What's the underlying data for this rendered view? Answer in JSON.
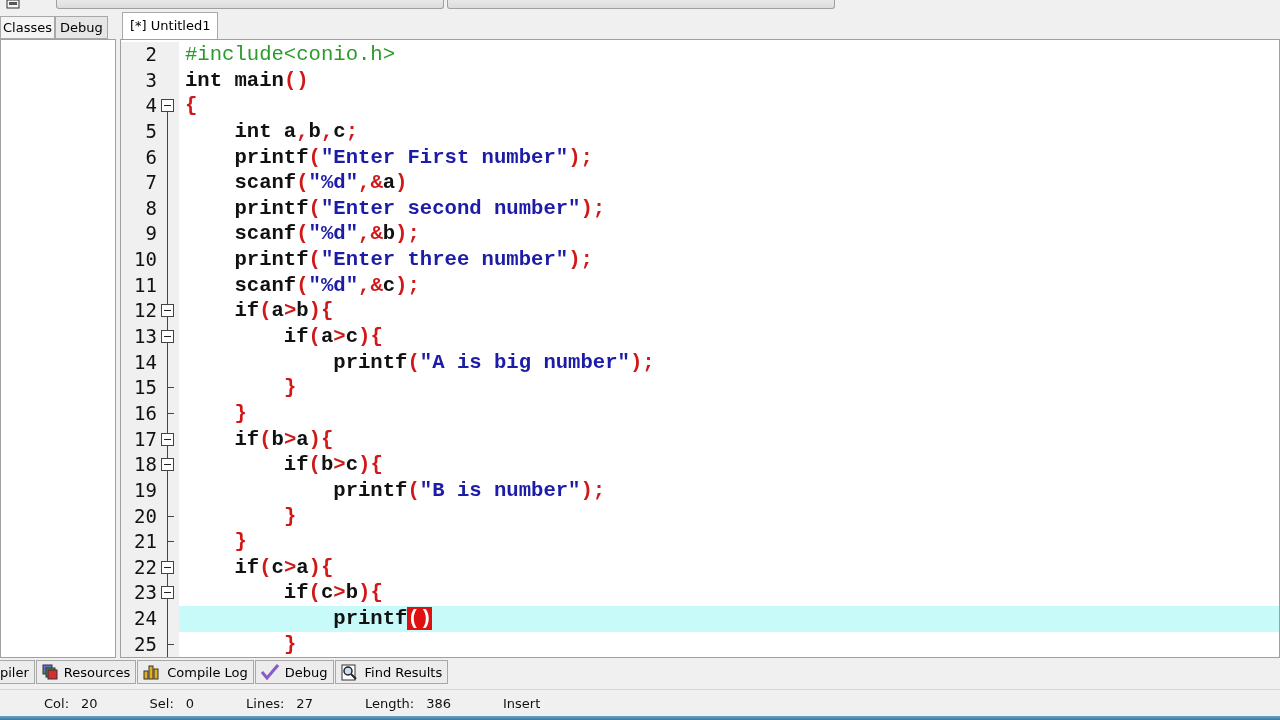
{
  "left_panel": {
    "tabs": [
      {
        "label": "Classes",
        "selected": true
      },
      {
        "label": "Debug",
        "selected": false
      }
    ]
  },
  "editor": {
    "tab": {
      "label": "[*] Untitled1"
    },
    "lines": [
      {
        "number": "2",
        "kind": "none",
        "code": "#include<conio.h>",
        "current": false
      },
      {
        "number": "3",
        "kind": "none",
        "code": "int main()",
        "current": false
      },
      {
        "number": "4",
        "kind": "start",
        "code": "{",
        "current": false
      },
      {
        "number": "5",
        "kind": "body",
        "code": "    int a,b,c;",
        "current": false
      },
      {
        "number": "6",
        "kind": "body",
        "code": "    printf(\"Enter First number\");",
        "current": false
      },
      {
        "number": "7",
        "kind": "body",
        "code": "    scanf(\"%d\",&a)",
        "current": false
      },
      {
        "number": "8",
        "kind": "body",
        "code": "    printf(\"Enter second number\");",
        "current": false
      },
      {
        "number": "9",
        "kind": "body",
        "code": "    scanf(\"%d\",&b);",
        "current": false
      },
      {
        "number": "10",
        "kind": "body",
        "code": "    printf(\"Enter three number\");",
        "current": false
      },
      {
        "number": "11",
        "kind": "body",
        "code": "    scanf(\"%d\",&c);",
        "current": false
      },
      {
        "number": "12",
        "kind": "start",
        "code": "    if(a>b){",
        "current": false
      },
      {
        "number": "13",
        "kind": "start",
        "code": "        if(a>c){",
        "current": false
      },
      {
        "number": "14",
        "kind": "body",
        "code": "            printf(\"A is big number\");",
        "current": false
      },
      {
        "number": "15",
        "kind": "end",
        "code": "        }",
        "current": false
      },
      {
        "number": "16",
        "kind": "end",
        "code": "    }",
        "current": false
      },
      {
        "number": "17",
        "kind": "start",
        "code": "    if(b>a){",
        "current": false
      },
      {
        "number": "18",
        "kind": "start",
        "code": "        if(b>c){",
        "current": false
      },
      {
        "number": "19",
        "kind": "body",
        "code": "            printf(\"B is number\");",
        "current": false
      },
      {
        "number": "20",
        "kind": "end",
        "code": "        }",
        "current": false
      },
      {
        "number": "21",
        "kind": "end",
        "code": "    }",
        "current": false
      },
      {
        "number": "22",
        "kind": "start",
        "code": "    if(c>a){",
        "current": false
      },
      {
        "number": "23",
        "kind": "start",
        "code": "        if(c>b){",
        "current": false
      },
      {
        "number": "24",
        "kind": "body",
        "code": "            printf",
        "matched_brackets": "()",
        "current": true
      },
      {
        "number": "25",
        "kind": "end",
        "code": "        }",
        "current": false
      }
    ]
  },
  "bottom_tabs": [
    {
      "label": "piler",
      "kind": "plain"
    },
    {
      "label": "Resources",
      "kind": "resources"
    },
    {
      "label": "Compile Log",
      "kind": "chart"
    },
    {
      "label": "Debug",
      "kind": "check"
    },
    {
      "label": "Find Results",
      "kind": "find"
    }
  ],
  "status_bar": [
    {
      "label": "Col:",
      "value": "20"
    },
    {
      "label": "Sel:",
      "value": "0"
    },
    {
      "label": "Lines:",
      "value": "27"
    },
    {
      "label": "Length:",
      "value": "386"
    },
    {
      "value": "Insert"
    }
  ]
}
